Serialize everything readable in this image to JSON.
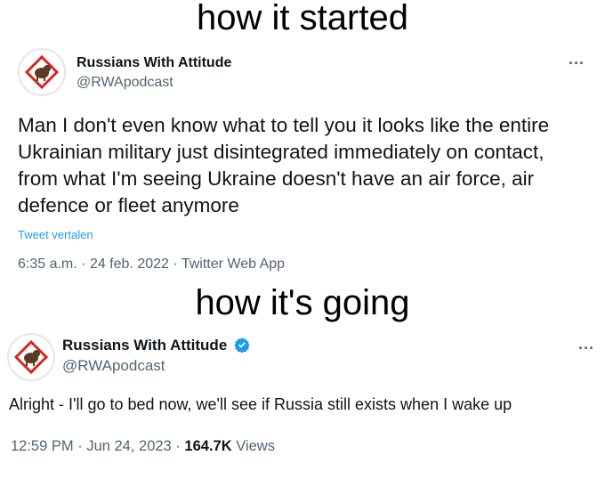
{
  "captions": {
    "top": "how it started",
    "middle": "how it's going"
  },
  "tweet1": {
    "name": "Russians With Attitude",
    "handle": "@RWApodcast",
    "text": "Man I don't even know what to tell you it looks like the entire Ukrainian military just disintegrated immediately on contact, from what I'm seeing Ukraine doesn't have an air force, air defence or fleet anymore",
    "translate": "Tweet vertalen",
    "time": "6:35 a.m.",
    "date": "24 feb. 2022",
    "source": "Twitter Web App",
    "more": "..."
  },
  "tweet2": {
    "name": "Russians With Attitude",
    "handle": "@RWApodcast",
    "text": "Alright - I'll go to bed now, we'll see if Russia still exists when I wake up",
    "time": "12:59 PM",
    "date": "Jun 24, 2023",
    "views_count": "164.7K",
    "views_label": "Views",
    "more": "...",
    "verified": true
  },
  "colors": {
    "link": "#1d9bf0",
    "muted": "#536471",
    "text": "#0f1419",
    "logo_red": "#d7261e"
  },
  "icons": {
    "avatar": "rwa-logo-icon",
    "verified": "verified-badge-icon",
    "more": "more-options-icon"
  }
}
